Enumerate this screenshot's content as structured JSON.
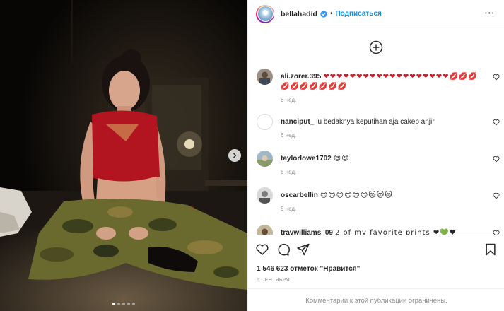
{
  "header": {
    "username": "bellahadid",
    "separator": "•",
    "follow_label": "Подписаться",
    "more_icon": "more-horizontal-icon"
  },
  "media": {
    "carousel_dot_count": 5,
    "active_dot_index": 0,
    "next_icon": "chevron-right-icon"
  },
  "comments": [
    {
      "username": "ali.zorer.395",
      "text": "❤❤❤❤❤❤❤❤❤❤❤❤❤❤❤❤❤❤❤💋💋💋💋💋💋💋💋💋💋",
      "time": "6 нед."
    },
    {
      "username": "nanciput_",
      "text": "lu bedaknya keputihan aja cakep anjir",
      "time": "6 нед."
    },
    {
      "username": "taylorlowe1702",
      "text": "😍😍",
      "time": "6 нед."
    },
    {
      "username": "oscarbellin",
      "text": "😍😍😍😍😍😍😻😻😻",
      "time": "5 нед."
    },
    {
      "username": "travwilliams_09",
      "text": "2 of my favorite prints ❤💚♥",
      "time": ""
    }
  ],
  "actions": {
    "likes_text": "1 546 623 отметок \"Нравится\"",
    "date": "6 СЕНТЯБРЯ",
    "comments_restricted": "Комментарии к этой публикации ограничены."
  },
  "colors": {
    "accent": "#0095f6",
    "muted": "#8e8e8e",
    "text": "#262626",
    "like_heart": "#ed4956"
  }
}
